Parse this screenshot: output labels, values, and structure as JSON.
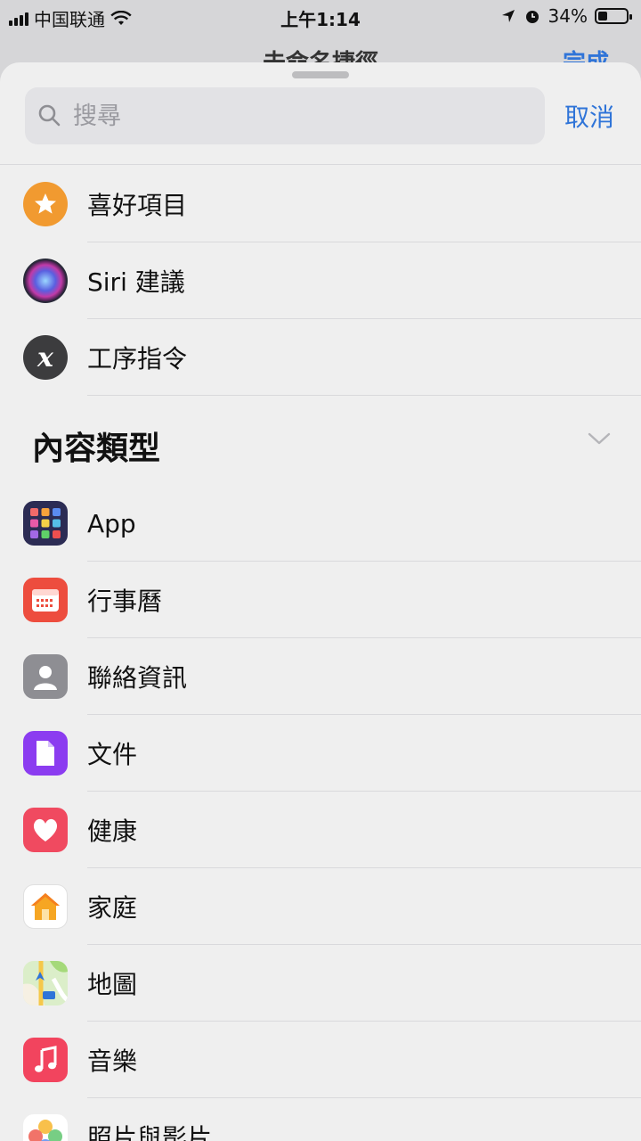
{
  "status_bar": {
    "carrier": "中国联通",
    "time": "上午1:14",
    "battery": "34%"
  },
  "background": {
    "title": "未命名捷徑",
    "done": "完成"
  },
  "search": {
    "placeholder": "搜尋",
    "cancel": "取消"
  },
  "top_items": [
    {
      "label": "喜好項目",
      "icon": "star-icon"
    },
    {
      "label": "Siri 建議",
      "icon": "siri-icon"
    },
    {
      "label": "工序指令",
      "icon": "script-x-icon"
    }
  ],
  "section": {
    "title": "內容類型"
  },
  "content_items": [
    {
      "label": "App",
      "icon": "app-grid-icon"
    },
    {
      "label": "行事曆",
      "icon": "calendar-icon"
    },
    {
      "label": "聯絡資訊",
      "icon": "contact-icon"
    },
    {
      "label": "文件",
      "icon": "document-icon"
    },
    {
      "label": "健康",
      "icon": "heart-icon"
    },
    {
      "label": "家庭",
      "icon": "home-icon"
    },
    {
      "label": "地圖",
      "icon": "map-icon"
    },
    {
      "label": "音樂",
      "icon": "music-icon"
    },
    {
      "label": "照片與影片",
      "icon": "photos-icon"
    }
  ],
  "colors": {
    "accent": "#2f74d8"
  }
}
